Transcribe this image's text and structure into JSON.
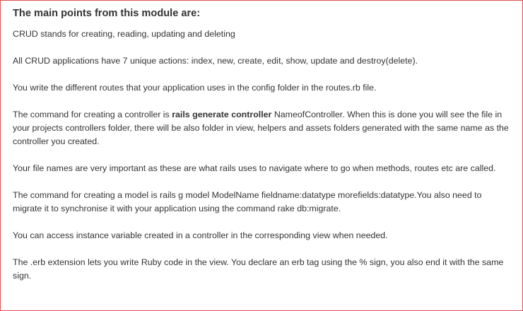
{
  "module": {
    "heading": "The main points from this module are:",
    "points": {
      "crud": "CRUD stands for creating, reading, updating and deleting",
      "actions": "All CRUD applications have 7 unique actions: index, new, create, edit, show, update and destroy(delete).",
      "routes": "You write the different routes that your application uses in the config folder in the routes.rb file.",
      "controller": {
        "before": "The command for creating a controller is ",
        "bold": "rails generate controller",
        "after": " NameofController. When this is done you will see the file in your projects controllers folder, there will be also folder in view, helpers and assets folders generated with the same name as the controller you created."
      },
      "file_names": "Your file names are very important as these are what rails uses to navigate where to go when methods, routes etc are called.",
      "model": "The command for creating a model is rails g model ModelName fieldname:datatype morefields:datatype.You also need to migrate it to synchronise it with your application using the command rake db:migrate.",
      "instance": "You can access instance variable created in a controller in the corresponding view when needed.",
      "erb": "The .erb extension lets you write Ruby code in the view. You declare an erb tag using the % sign, you also end it with the same sign."
    }
  }
}
